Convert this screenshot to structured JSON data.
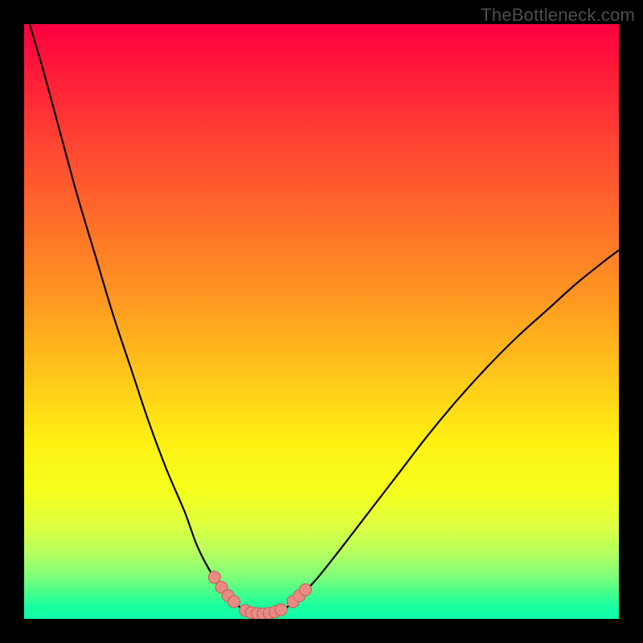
{
  "watermark": "TheBottleneck.com",
  "colors": {
    "frame": "#000000",
    "curve": "#000000",
    "marker_fill": "#e98a84",
    "marker_stroke": "#c06058"
  },
  "chart_data": {
    "type": "line",
    "title": "",
    "xlabel": "",
    "ylabel": "",
    "xlim": [
      0,
      100
    ],
    "ylim": [
      0,
      100
    ],
    "grid": false,
    "legend": false,
    "series": [
      {
        "name": "left-branch",
        "x": [
          0,
          3,
          6,
          9,
          12,
          15,
          18,
          21,
          24,
          27,
          29,
          31,
          33,
          35,
          36.5,
          37.5
        ],
        "y": [
          103,
          93,
          82,
          71,
          61,
          51,
          42,
          33,
          25,
          18,
          12.5,
          8.5,
          5.5,
          3.2,
          1.8,
          1.2
        ]
      },
      {
        "name": "right-branch",
        "x": [
          42.5,
          44,
          46,
          49,
          53,
          58,
          63,
          68,
          73,
          78,
          83,
          88,
          93,
          98,
          100
        ],
        "y": [
          1.2,
          1.8,
          3.5,
          6.5,
          11.5,
          18,
          24.5,
          31,
          37,
          42.5,
          47.5,
          52,
          56.5,
          60.5,
          62
        ]
      },
      {
        "name": "valley-floor",
        "x": [
          37.5,
          38.5,
          40,
          41.5,
          42.5
        ],
        "y": [
          1.2,
          0.9,
          0.85,
          0.9,
          1.2
        ]
      }
    ],
    "markers": [
      {
        "name": "left-outer-top",
        "x": 32.0,
        "y": 7.0
      },
      {
        "name": "left-mid",
        "x": 33.2,
        "y": 5.3
      },
      {
        "name": "left-inner",
        "x": 34.3,
        "y": 3.9
      },
      {
        "name": "left-inner-low",
        "x": 35.3,
        "y": 2.9
      },
      {
        "name": "floor-left-a",
        "x": 37.2,
        "y": 1.4
      },
      {
        "name": "floor-left-b",
        "x": 38.2,
        "y": 1.05
      },
      {
        "name": "floor-mid-a",
        "x": 39.2,
        "y": 0.9
      },
      {
        "name": "floor-mid-b",
        "x": 40.2,
        "y": 0.85
      },
      {
        "name": "floor-mid-c",
        "x": 41.2,
        "y": 0.95
      },
      {
        "name": "floor-right-a",
        "x": 42.2,
        "y": 1.2
      },
      {
        "name": "floor-right-b",
        "x": 43.2,
        "y": 1.55
      },
      {
        "name": "right-inner-a",
        "x": 45.2,
        "y": 2.9
      },
      {
        "name": "right-inner-b",
        "x": 46.3,
        "y": 3.9
      },
      {
        "name": "right-outer",
        "x": 47.3,
        "y": 4.9
      }
    ]
  }
}
